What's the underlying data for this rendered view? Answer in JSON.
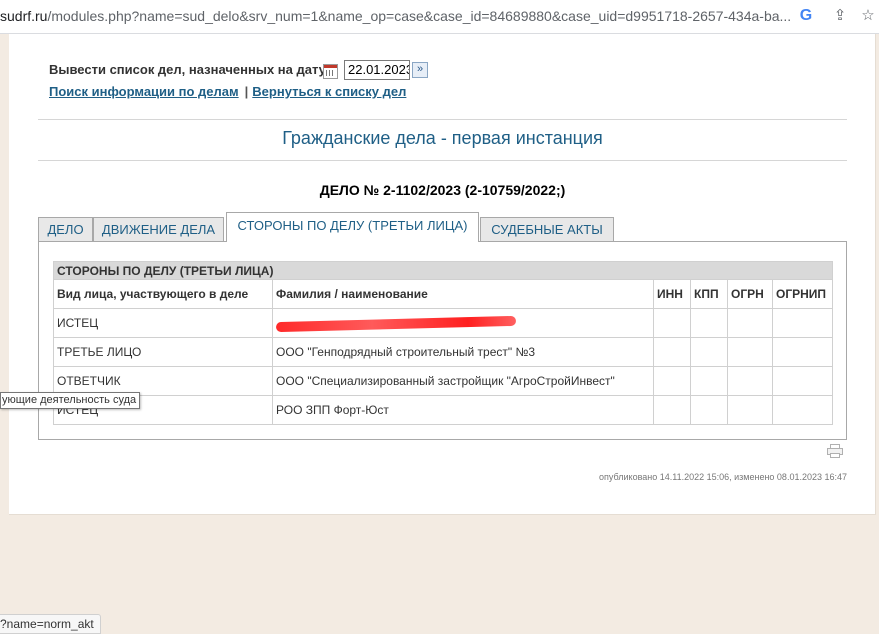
{
  "browser": {
    "url_host": "sudrf.ru",
    "url_rest": "/modules.php?name=sud_delo&srv_num=1&name_op=case&case_id=84689880&case_uid=d9951718-2657-434a-ba...",
    "icons": [
      "google-icon",
      "share-icon",
      "star-icon"
    ],
    "status_url": "?name=norm_akt"
  },
  "datefilter": {
    "label": "Вывести список дел, назначенных на дату",
    "date_value": "22.01.2023",
    "go_symbol": "»"
  },
  "links": {
    "search": "Поиск информации по делам",
    "separator": "|",
    "back": "Вернуться к списку дел"
  },
  "section_heading": "Гражданские дела - первая инстанция",
  "case_title": "ДЕЛО № 2-1102/2023 (2-10759/2022;)",
  "tabs": [
    {
      "label": "ДЕЛО"
    },
    {
      "label": "ДВИЖЕНИЕ ДЕЛА"
    },
    {
      "label": "СТОРОНЫ ПО ДЕЛУ (ТРЕТЬИ ЛИЦА)",
      "active": true
    },
    {
      "label": "СУДЕБНЫЕ АКТЫ"
    }
  ],
  "parties_table": {
    "caption": "СТОРОНЫ ПО ДЕЛУ (ТРЕТЬИ ЛИЦА)",
    "headers": [
      "Вид лица, участвующего в деле",
      "Фамилия / наименование",
      "ИНН",
      "КПП",
      "ОГРН",
      "ОГРНИП"
    ],
    "rows": [
      {
        "role": "ИСТЕЦ",
        "name": "",
        "redacted": true
      },
      {
        "role": "ТРЕТЬЕ ЛИЦО",
        "name": "ООО \"Генподрядный строительный трест\" №3"
      },
      {
        "role": "ОТВЕТЧИК",
        "name": "ООО \"Специализированный застройщик \"АгроСтройИнвест\""
      },
      {
        "role": "ИСТЕЦ",
        "name": "РОО ЗПП Форт-Юст"
      }
    ]
  },
  "published": "опубликовано 14.11.2022 15:06, изменено 08.01.2023 16:47",
  "tooltip": "ующие деятельность суда",
  "colors": {
    "link": "#1f5f86",
    "redaction": "#ff2a2a",
    "caption_bg": "#d9d9d9"
  }
}
